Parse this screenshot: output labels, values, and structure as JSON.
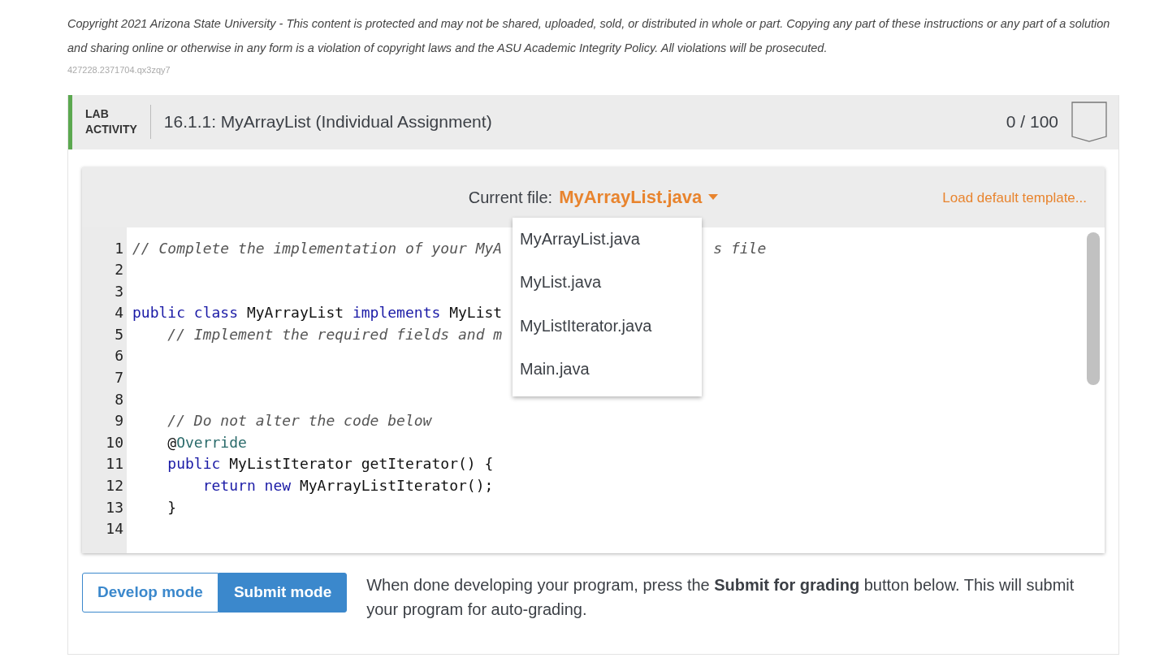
{
  "notice": {
    "copyright": "Copyright 2021 Arizona State University - This content is protected and may not be shared, uploaded, sold, or distributed in whole or part. Copying any part of these instructions or any part of a solution and sharing online or otherwise in any form is a violation of copyright laws and the ASU Academic Integrity Policy. All violations will be prosecuted.",
    "code": "427228.2371704.qx3zqy7"
  },
  "activity": {
    "type_line1": "LAB",
    "type_line2": "ACTIVITY",
    "title": "16.1.1: MyArrayList (Individual Assignment)",
    "score": "0 / 100"
  },
  "editor": {
    "current_file_label": "Current file:",
    "current_file": "MyArrayList.java",
    "load_template": "Load default template...",
    "file_menu": {
      "open": true,
      "items": [
        "MyArrayList.java",
        "MyList.java",
        "MyListIterator.java",
        "Main.java"
      ]
    },
    "lines": [
      {
        "number": "1",
        "segments": [
          {
            "kind": "comment",
            "text": "// Complete the implementation of your MyA"
          },
          {
            "kind": "hidden"
          },
          {
            "kind": "comment",
            "text": "s file"
          }
        ]
      },
      {
        "number": "2"
      },
      {
        "number": "3"
      },
      {
        "number": "4",
        "segments": [
          {
            "kind": "keyword",
            "text": "public class"
          },
          {
            "kind": "plain",
            "text": " MyArrayList "
          },
          {
            "kind": "keyword",
            "text": "implements"
          },
          {
            "kind": "plain",
            "text": " MyList"
          }
        ]
      },
      {
        "number": "5",
        "segments": [
          {
            "kind": "comment",
            "text": "    // Implement the required fields and m"
          }
        ]
      },
      {
        "number": "6"
      },
      {
        "number": "7"
      },
      {
        "number": "8"
      },
      {
        "number": "9",
        "segments": [
          {
            "kind": "comment",
            "text": "    // Do not alter the code below"
          }
        ]
      },
      {
        "number": "10",
        "segments": [
          {
            "kind": "plain",
            "text": "    @"
          },
          {
            "kind": "annotation",
            "text": "Override"
          }
        ]
      },
      {
        "number": "11",
        "segments": [
          {
            "kind": "keyword",
            "text": "    public"
          },
          {
            "kind": "plain",
            "text": " MyListIterator getIterator() {"
          }
        ]
      },
      {
        "number": "12",
        "segments": [
          {
            "kind": "keyword",
            "text": "        return new"
          },
          {
            "kind": "plain",
            "text": " MyArrayListIterator();"
          }
        ]
      },
      {
        "number": "13",
        "segments": [
          {
            "kind": "plain",
            "text": "    }"
          }
        ]
      },
      {
        "number": "14"
      }
    ]
  },
  "modes": [
    {
      "label": "Develop mode",
      "selected": false
    },
    {
      "label": "Submit mode",
      "selected": true
    }
  ],
  "instructions": "When done developing your program, press the **Submit for grading** button below. This will submit your program for auto-grading."
}
